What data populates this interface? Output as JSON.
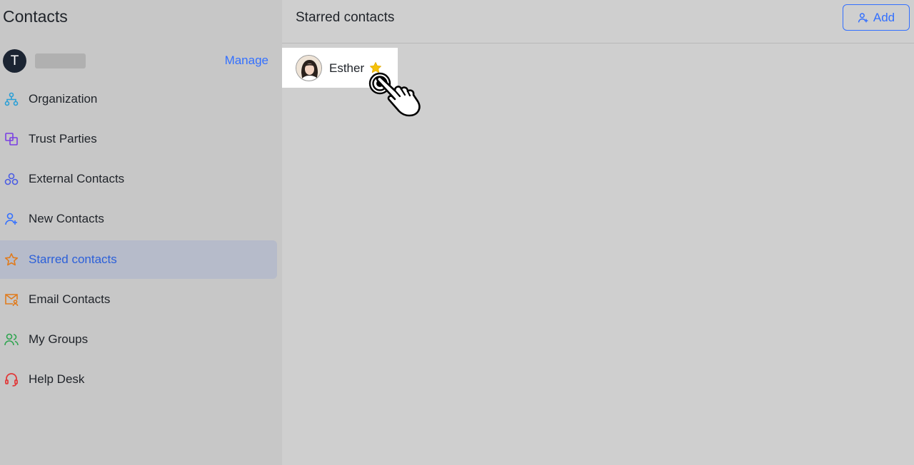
{
  "sidebar": {
    "title": "Contacts",
    "account": {
      "avatar_letter": "T",
      "manage_label": "Manage"
    },
    "items": [
      {
        "label": "Organization",
        "icon": "organization-icon",
        "color": "#2a9fd6"
      },
      {
        "label": "Trust Parties",
        "icon": "trust-parties-icon",
        "color": "#7a3fe4"
      },
      {
        "label": "External Contacts",
        "icon": "external-contacts-icon",
        "color": "#4a5ce4"
      },
      {
        "label": "New Contacts",
        "icon": "new-contact-icon",
        "color": "#3370ff"
      },
      {
        "label": "Starred contacts",
        "icon": "star-outline-icon",
        "color": "#e07b1d",
        "active": true
      },
      {
        "label": "Email Contacts",
        "icon": "email-contacts-icon",
        "color": "#e07b1d"
      },
      {
        "label": "My Groups",
        "icon": "groups-icon",
        "color": "#2ea44f"
      },
      {
        "label": "Help Desk",
        "icon": "headset-icon",
        "color": "#e03a3a"
      }
    ]
  },
  "main": {
    "title": "Starred contacts",
    "add_label": "Add",
    "contacts": [
      {
        "name": "Esther",
        "starred": true
      }
    ]
  },
  "colors": {
    "accent": "#3370ff",
    "active_bg": "#b6bbca",
    "star": "#f5c20b"
  }
}
